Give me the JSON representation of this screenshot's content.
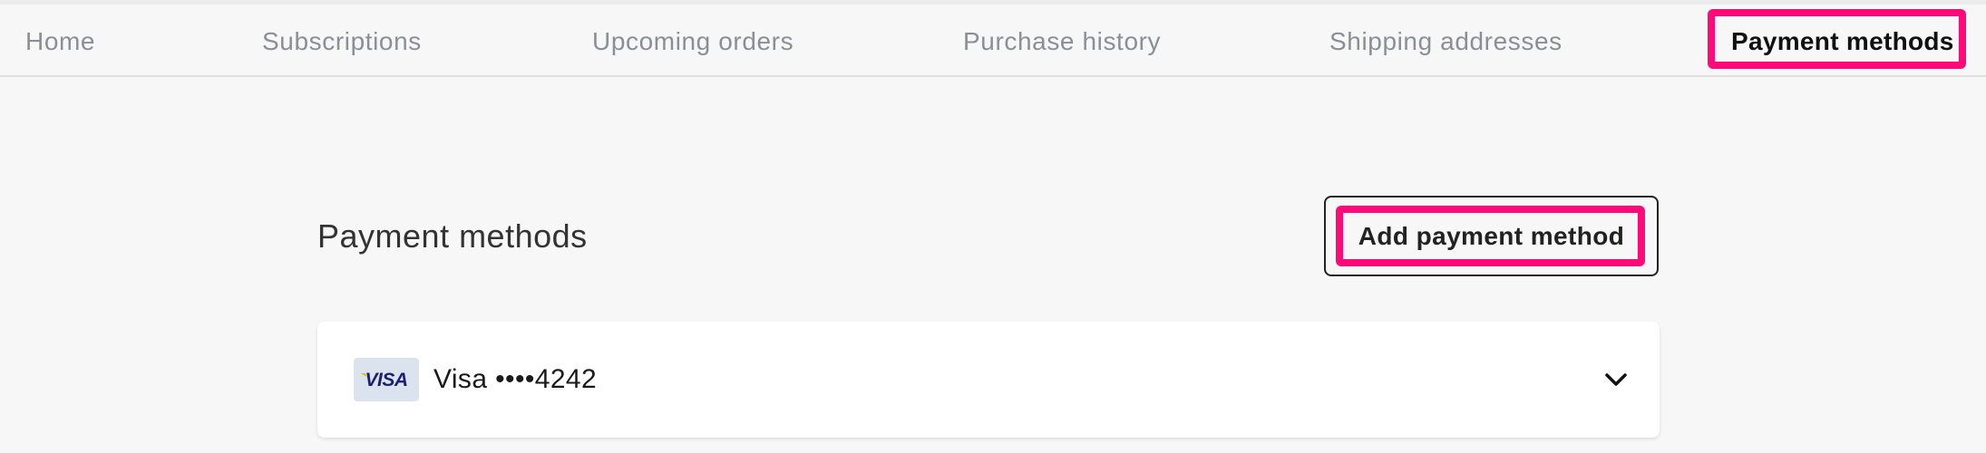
{
  "nav": {
    "items": [
      {
        "label": "Home"
      },
      {
        "label": "Subscriptions"
      },
      {
        "label": "Upcoming orders"
      },
      {
        "label": "Purchase history"
      },
      {
        "label": "Shipping addresses"
      },
      {
        "label": "Payment methods",
        "active": true
      }
    ]
  },
  "main": {
    "title": "Payment methods",
    "add_button_label": "Add payment method",
    "payment_methods": [
      {
        "brand": "VISA",
        "label": "Visa ••••4242",
        "expand_icon": "chevron-down-icon"
      }
    ]
  },
  "colors": {
    "highlight": "#ff0a78",
    "background": "#f7f7f7",
    "nav_inactive_text": "#8a8f96",
    "nav_active_text": "#111111",
    "visa_blue": "#1a1f71",
    "visa_gold": "#f7b600"
  }
}
